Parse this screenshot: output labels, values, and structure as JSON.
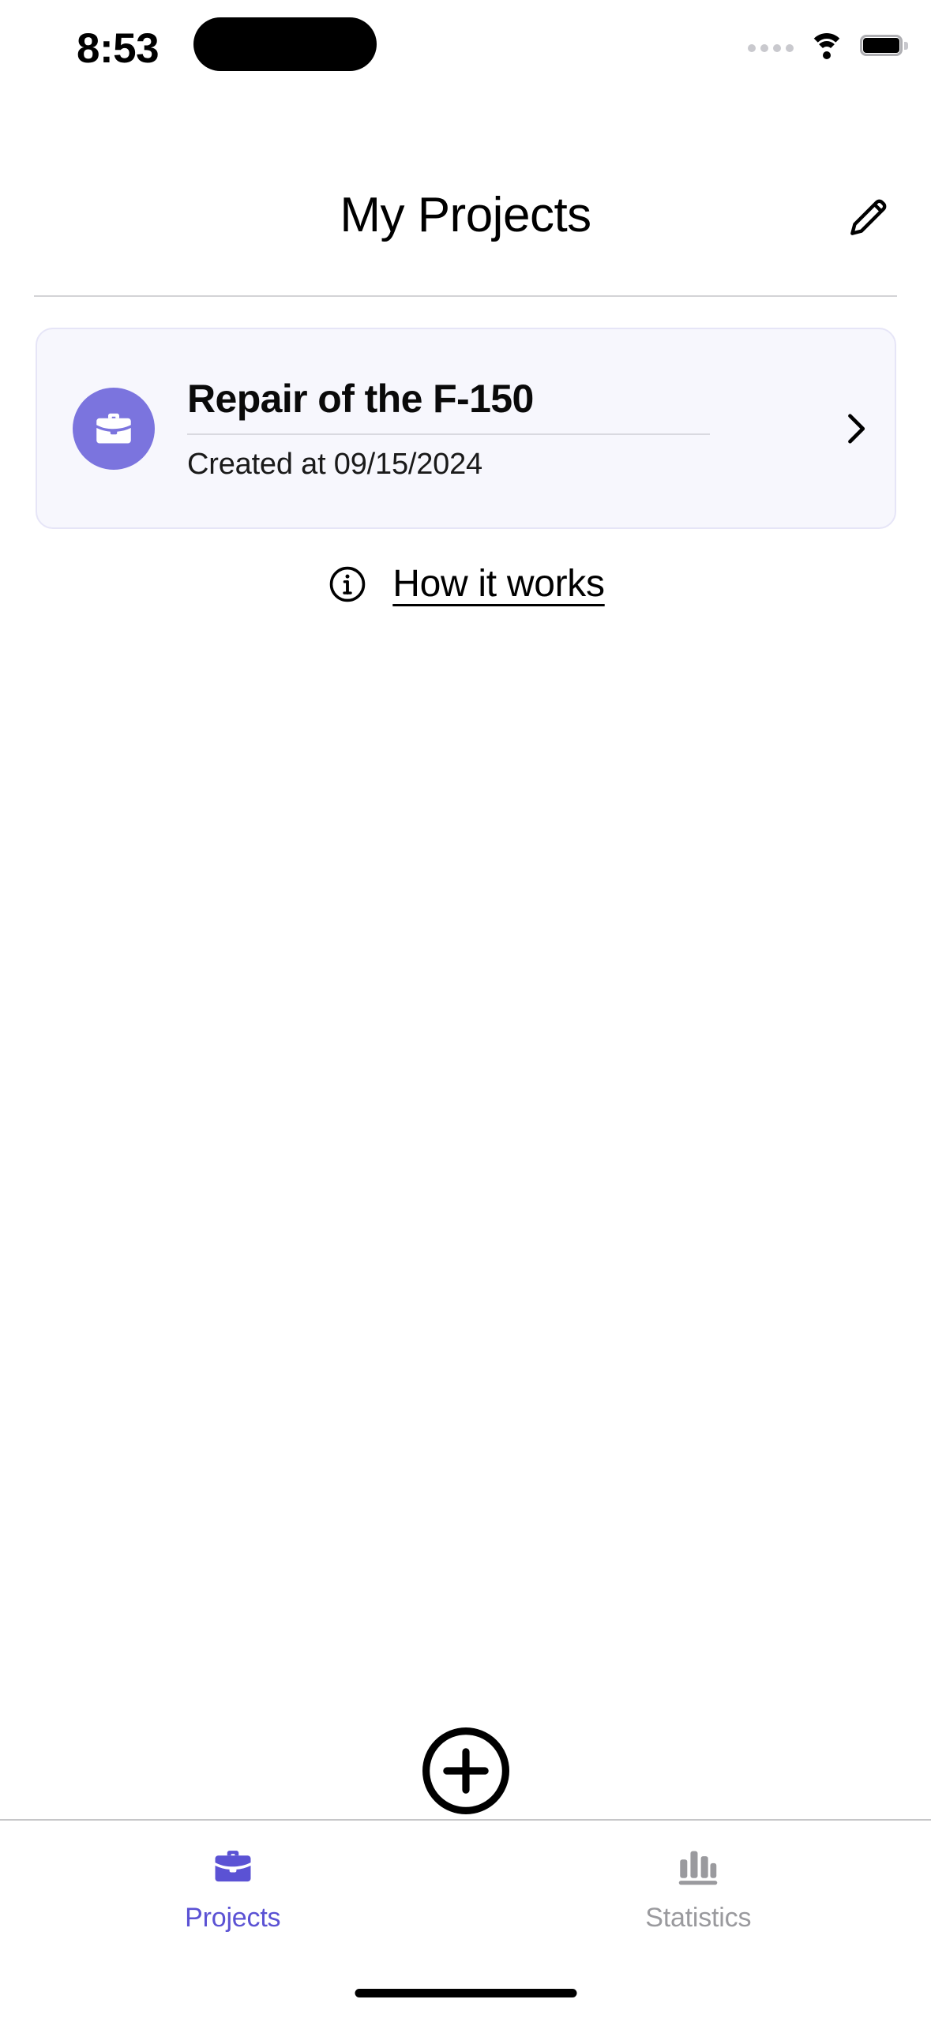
{
  "status_bar": {
    "time": "8:53",
    "cellular_icon": "cellular-dots-icon",
    "wifi_icon": "wifi-icon",
    "battery_icon": "battery-full-icon"
  },
  "header": {
    "title": "My Projects",
    "edit_icon": "pencil-icon"
  },
  "projects": [
    {
      "avatar_icon": "briefcase-icon",
      "title": "Repair of the F-150",
      "subtitle": "Created at 09/15/2024",
      "chevron_icon": "chevron-right-icon"
    }
  ],
  "how_it_works": {
    "icon": "info-circle-icon",
    "label": "How it works"
  },
  "add_button": {
    "icon": "plus-circle-icon"
  },
  "tabbar": {
    "items": [
      {
        "label": "Projects",
        "icon": "briefcase-icon",
        "active": true
      },
      {
        "label": "Statistics",
        "icon": "bar-chart-icon",
        "active": false
      }
    ]
  },
  "colors": {
    "accent": "#5b52d4",
    "avatar_purple": "#7b74de",
    "card_background": "#f7f7fd",
    "card_border": "#e6e5f7",
    "inactive_tab": "#9a9a9e",
    "divider": "#d3d3d6"
  }
}
